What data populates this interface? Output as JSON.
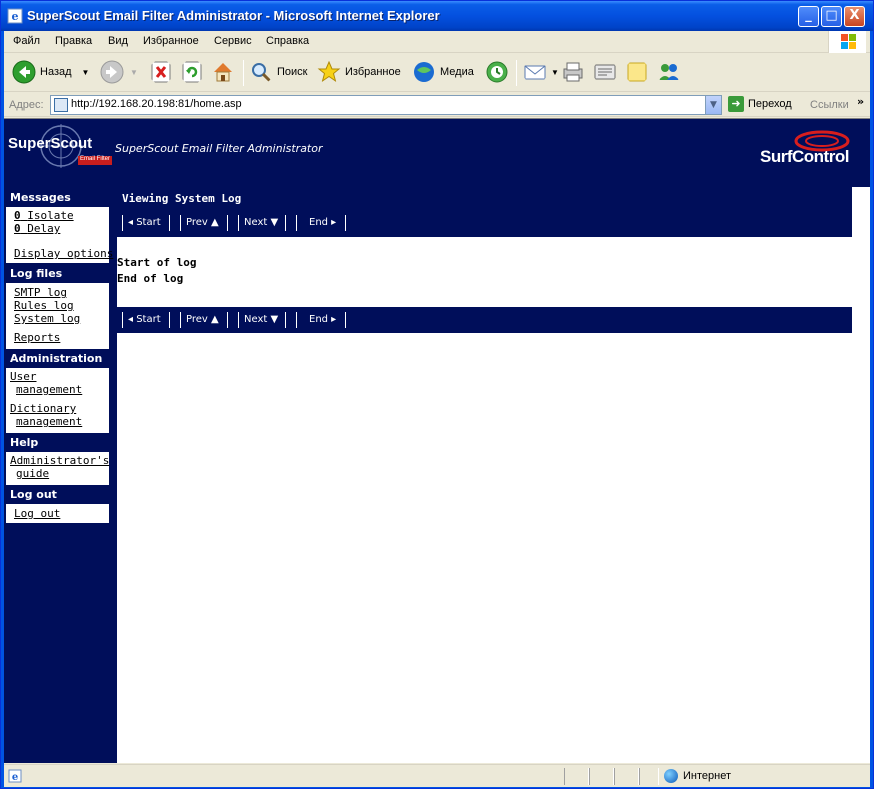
{
  "window": {
    "title": "SuperScout Email Filter Administrator - Microsoft Internet Explorer",
    "minimize": "_",
    "maximize": "□",
    "close": "X"
  },
  "menu": {
    "items": [
      "Файл",
      "Правка",
      "Вид",
      "Избранное",
      "Сервис",
      "Справка"
    ]
  },
  "toolbar": {
    "back": "Назад",
    "search": "Поиск",
    "favorites": "Избранное",
    "media": "Медиа"
  },
  "address": {
    "label": "Адрес:",
    "url": "http://192.168.20.198:81/home.asp",
    "go": "Переход",
    "links": "Ссылки",
    "more": "»"
  },
  "page": {
    "header_title": "SuperScout Email Filter Administrator",
    "logo_left": "SuperScout",
    "logo_left_sub": "Email Filter",
    "logo_right": "SurfControl"
  },
  "sidebar": {
    "messages": {
      "heading": "Messages",
      "isolate_count": "0",
      "isolate_label": "Isolate",
      "delay_count": "0",
      "delay_label": "Delay",
      "display_options": "Display options"
    },
    "logfiles": {
      "heading": "Log files",
      "smtp": "SMTP log",
      "rules": "Rules log",
      "system": "System log",
      "reports": "Reports"
    },
    "administration": {
      "heading": "Administration",
      "user_1": "User",
      "user_2": "management",
      "dict_1": "Dictionary",
      "dict_2": "management"
    },
    "help": {
      "heading": "Help",
      "guide_1": "Administrator's",
      "guide_2": "guide"
    },
    "logout": {
      "heading": "Log out",
      "link": "Log out"
    }
  },
  "content": {
    "title": "Viewing System Log",
    "nav": {
      "start": "◂ Start",
      "prev": "Prev ▲",
      "next": "Next ▼",
      "end": "End ▸"
    },
    "log_start": "Start of log",
    "log_end": "End of log"
  },
  "status": {
    "zone": "Интернет"
  }
}
